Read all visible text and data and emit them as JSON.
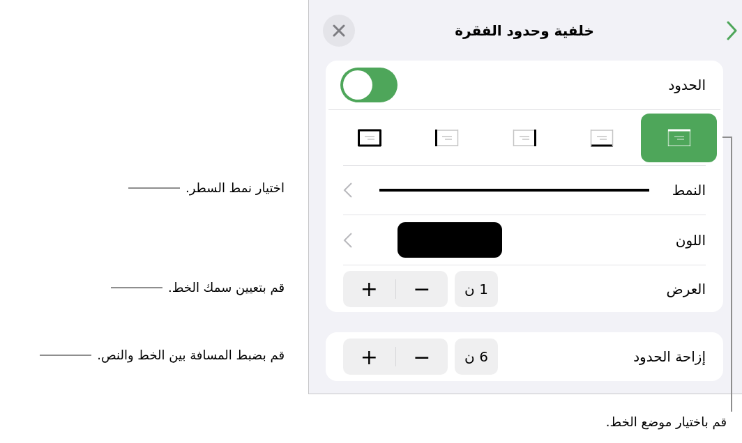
{
  "panel": {
    "title": "خلفية وحدود الفقرة",
    "borders": {
      "label": "الحدود",
      "on": true
    },
    "positions": [
      {
        "kind": "top",
        "selected": true
      },
      {
        "kind": "bottom",
        "selected": false
      },
      {
        "kind": "right",
        "selected": false
      },
      {
        "kind": "left",
        "selected": false
      },
      {
        "kind": "all",
        "selected": false
      }
    ],
    "style": {
      "label": "النمط"
    },
    "color": {
      "label": "اللون",
      "color": "#000000"
    },
    "width": {
      "label": "العرض",
      "value": "1 ن",
      "decrement": "−",
      "increment": "+"
    },
    "offset": {
      "label": "إزاحة الحدود",
      "value": "6 ن",
      "decrement": "−",
      "increment": "+"
    }
  },
  "callouts": [
    {
      "text": "اختيار نمط السطر."
    },
    {
      "text": "قم بتعيين سمك الخط."
    },
    {
      "text": "قم بضبط المسافة بين الخط والنص."
    },
    {
      "text": "قم باختيار موضع الخط."
    }
  ]
}
